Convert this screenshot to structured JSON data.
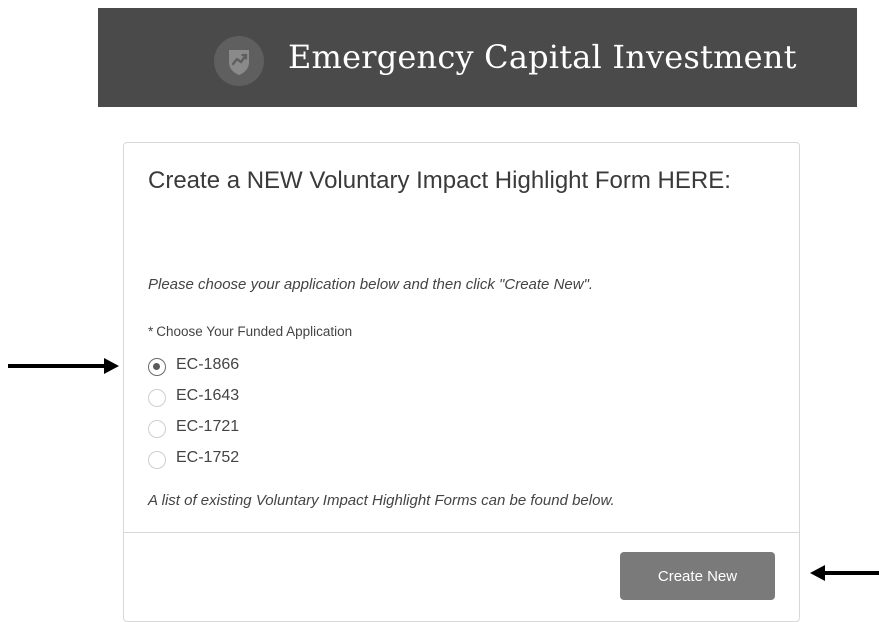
{
  "header": {
    "title": "Emergency Capital Investment",
    "logo_icon": "shield-chart-icon"
  },
  "form": {
    "title": "Create a NEW Voluntary Impact Highlight Form HERE:",
    "instruction": "Please choose your application below and then click \"Create New\".",
    "field_label": "Choose Your Funded Application",
    "required_marker": "*",
    "options": [
      {
        "label": "EC-1866",
        "selected": true
      },
      {
        "label": "EC-1643",
        "selected": false
      },
      {
        "label": "EC-1721",
        "selected": false
      },
      {
        "label": "EC-1752",
        "selected": false
      }
    ],
    "note": "A list of existing Voluntary Impact Highlight Forms can be found below.",
    "create_button_label": "Create New"
  },
  "annotations": {
    "left_arrow_icon": "arrow-right-icon",
    "right_arrow_icon": "arrow-left-icon"
  },
  "colors": {
    "header_bg": "#4a4a4a",
    "button_bg": "#7a7a7a",
    "arrow": "#000000"
  }
}
